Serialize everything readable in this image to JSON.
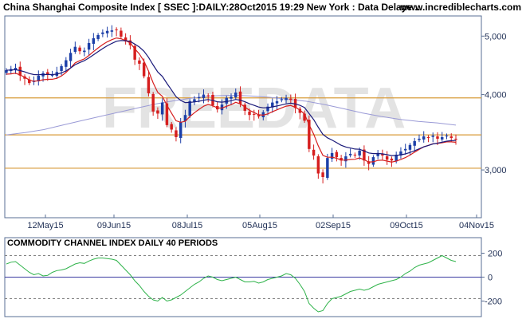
{
  "header": {
    "title": "China Shanghai Composite Index [ SSEC ]:DAILY:28Oct2015 19:29 New York : Data Delaye...",
    "site": "www.incrediblecharts.com"
  },
  "watermark": "FREEDATA",
  "colors": {
    "candle_up": "#1c3fa8",
    "candle_down": "#d61e1e",
    "ma_fast": "#d61e1e",
    "ma_slow": "#1a1a7a",
    "ma_long": "#9a9ad6",
    "hline": "#d89b3a",
    "cci": "#2fb34a"
  },
  "chart_data": [
    {
      "type": "candlestick",
      "title": "China Shanghai Composite Index [ SSEC ]:DAILY:28Oct2015 19:29 New York : Data Delaye...",
      "x_ticks": [
        "12May15",
        "09Jun15",
        "08Jul15",
        "05Aug15",
        "02Sep15",
        "09Oct15",
        "04Nov15"
      ],
      "y_ticks": [
        5000,
        4000,
        3000
      ],
      "y_tick_labels": [
        "5,000",
        "4,000",
        "3,000"
      ],
      "ylim": [
        2500,
        5400
      ],
      "log_scale": true,
      "grid": false,
      "horizontal_lines": [
        3950,
        3430,
        3020
      ],
      "closes": [
        4390,
        4410,
        4430,
        4300,
        4250,
        4180,
        4220,
        4300,
        4340,
        4320,
        4310,
        4360,
        4460,
        4560,
        4690,
        4800,
        4720,
        4730,
        4870,
        4960,
        5020,
        5070,
        5100,
        5110,
        5120,
        4990,
        4900,
        4830,
        4570,
        4500,
        4290,
        4020,
        3750,
        3720,
        3880,
        3560,
        3500,
        3400,
        3600,
        3700,
        3900,
        3930,
        3960,
        4000,
        3980,
        3840,
        3780,
        3850,
        3950,
        3970,
        4030,
        3860,
        3760,
        3700,
        3710,
        3680,
        3740,
        3820,
        3880,
        3900,
        3930,
        3950,
        3920,
        3800,
        3730,
        3620,
        3250,
        3170,
        2960,
        2920,
        3140,
        3200,
        3150,
        3110,
        3160,
        3190,
        3180,
        3230,
        3110,
        3070,
        3150,
        3200,
        3170,
        3120,
        3110,
        3180,
        3220,
        3250,
        3300,
        3350,
        3380,
        3410,
        3390,
        3420,
        3380,
        3400,
        3420,
        3390,
        3370
      ],
      "ma_fast_label": "",
      "ma_slow_label": "",
      "ma_long": [
        3430,
        3460,
        3500,
        3560,
        3620,
        3680,
        3740,
        3800,
        3860,
        3910,
        3950,
        3980,
        3990,
        3980,
        3960,
        3930,
        3900,
        3850,
        3790,
        3730,
        3680,
        3640,
        3610,
        3590,
        3560
      ]
    },
    {
      "type": "line",
      "title": "COMMODITY CHANNEL INDEX DAILY 40 PERIODS",
      "y_ticks": [
        200,
        0,
        -200
      ],
      "y_tick_labels": [
        "200",
        "0",
        "-200"
      ],
      "ylim": [
        -330,
        330
      ],
      "reference_lines": [
        180,
        -180
      ],
      "zero_line": 0,
      "values": [
        110,
        125,
        130,
        100,
        70,
        40,
        20,
        30,
        10,
        15,
        40,
        55,
        60,
        70,
        90,
        110,
        120,
        115,
        135,
        150,
        160,
        160,
        155,
        150,
        140,
        100,
        60,
        20,
        -30,
        -70,
        -120,
        -160,
        -190,
        -200,
        -170,
        -200,
        -190,
        -170,
        -150,
        -120,
        -90,
        -60,
        -40,
        -10,
        10,
        0,
        -20,
        -30,
        -20,
        -10,
        0,
        -20,
        -40,
        -40,
        -35,
        -50,
        -40,
        -20,
        -10,
        0,
        10,
        30,
        20,
        -10,
        -60,
        -120,
        -220,
        -260,
        -290,
        -280,
        -220,
        -180,
        -170,
        -160,
        -140,
        -120,
        -110,
        -100,
        -110,
        -100,
        -80,
        -60,
        -50,
        -40,
        -30,
        -20,
        0,
        30,
        50,
        80,
        100,
        110,
        120,
        140,
        160,
        180,
        160,
        140,
        130
      ]
    }
  ]
}
